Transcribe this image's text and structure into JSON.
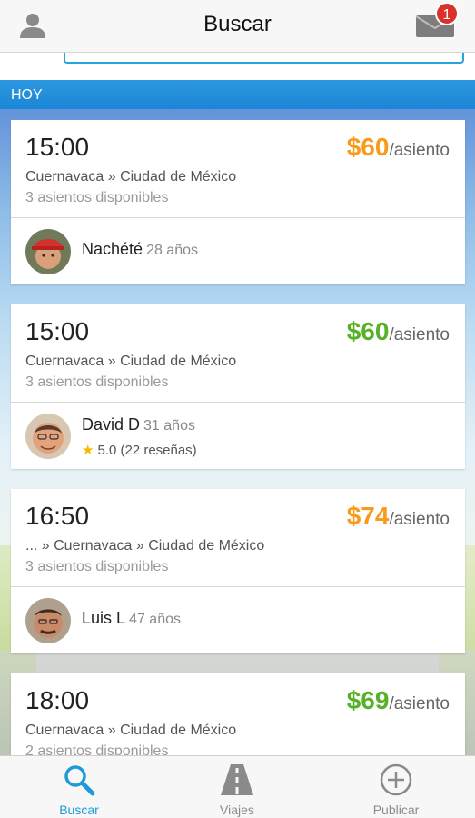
{
  "header": {
    "title": "Buscar",
    "notification_count": "1"
  },
  "section": {
    "label": "HOY"
  },
  "rides": [
    {
      "time": "15:00",
      "price": "$60",
      "price_unit": "/asiento",
      "price_color": "#f89b1c",
      "route": "Cuernavaca » Ciudad de México",
      "seats": "3 asientos disponibles",
      "driver": {
        "name": "Nachété",
        "age": "28 años"
      }
    },
    {
      "time": "15:00",
      "price": "$60",
      "price_unit": "/asiento",
      "price_color": "#56b128",
      "route": "Cuernavaca » Ciudad de México",
      "seats": "3 asientos disponibles",
      "driver": {
        "name": "David D",
        "age": "31 años",
        "rating": "5.0 (22 reseñas)"
      }
    },
    {
      "time": "16:50",
      "price": "$74",
      "price_unit": "/asiento",
      "price_color": "#f89b1c",
      "route": "... » Cuernavaca » Ciudad de México",
      "seats": "3 asientos disponibles",
      "driver": {
        "name": "Luis L",
        "age": "47 años"
      }
    },
    {
      "time": "18:00",
      "price": "$69",
      "price_unit": "/asiento",
      "price_color": "#56b128",
      "route": "Cuernavaca » Ciudad de México",
      "seats": "2 asientos disponibles"
    }
  ],
  "tabs": [
    {
      "label": "Buscar",
      "icon": "search-icon",
      "active": true
    },
    {
      "label": "Viajes",
      "icon": "road-icon",
      "active": false
    },
    {
      "label": "Publicar",
      "icon": "plus-circle-icon",
      "active": false
    }
  ],
  "colors": {
    "accent": "#1e9bd7",
    "price_orange": "#f89b1c",
    "price_green": "#56b128",
    "badge": "#d9312b"
  }
}
